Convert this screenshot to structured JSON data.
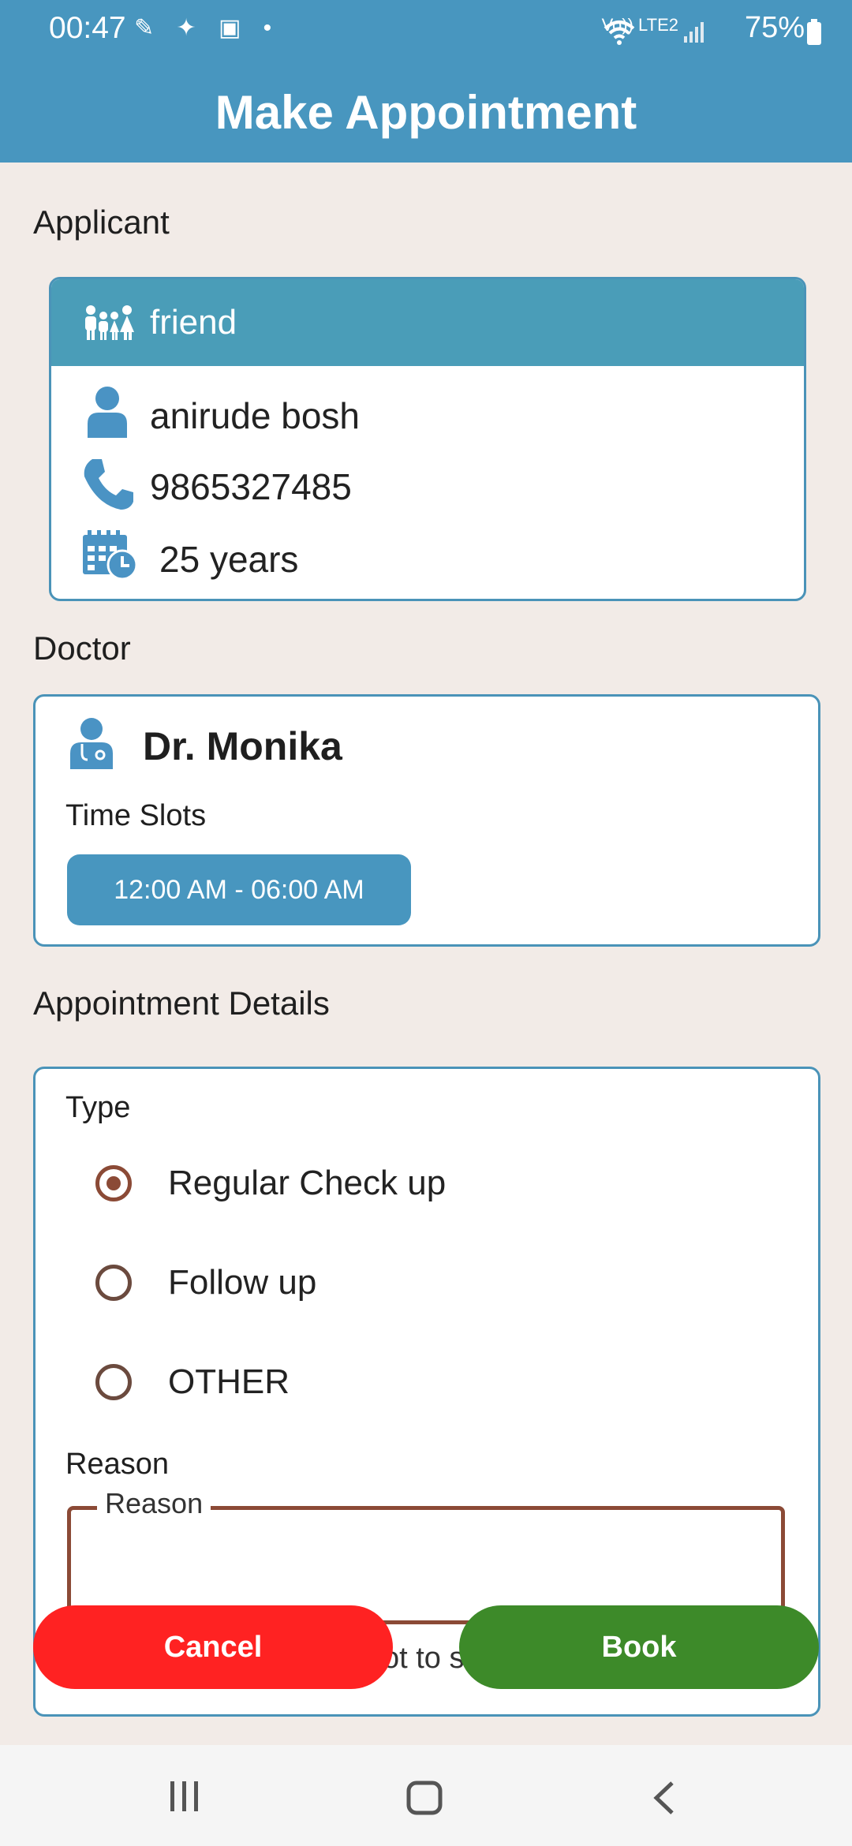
{
  "status_bar": {
    "time": "00:47",
    "network": "Vo)) LTE2",
    "battery": "75%"
  },
  "app_bar": {
    "title": "Make Appointment"
  },
  "applicant": {
    "section_title": "Applicant",
    "relation": "friend",
    "name": "anirude bosh",
    "phone": "9865327485",
    "age": "25 years"
  },
  "doctor": {
    "section_title": "Doctor",
    "name": "Dr. Monika",
    "time_slots_label": "Time Slots",
    "slots": [
      "12:00 AM - 06:00 AM"
    ]
  },
  "appointment_details": {
    "section_title": "Appointment Details",
    "type_label": "Type",
    "types": [
      {
        "label": "Regular Check up",
        "selected": true
      },
      {
        "label": "Follow up",
        "selected": false
      },
      {
        "label": "OTHER",
        "selected": false
      }
    ],
    "reason_label": "Reason",
    "reason_field_label": "Reason",
    "reason_value": "",
    "hint_partial": "ot to s"
  },
  "actions": {
    "cancel_label": "Cancel",
    "book_label": "Book"
  },
  "colors": {
    "primary": "#4896bf",
    "cancel": "#ff2222",
    "book": "#3d8a29",
    "radio": "#8b4a36",
    "background": "#f2ebe7"
  }
}
